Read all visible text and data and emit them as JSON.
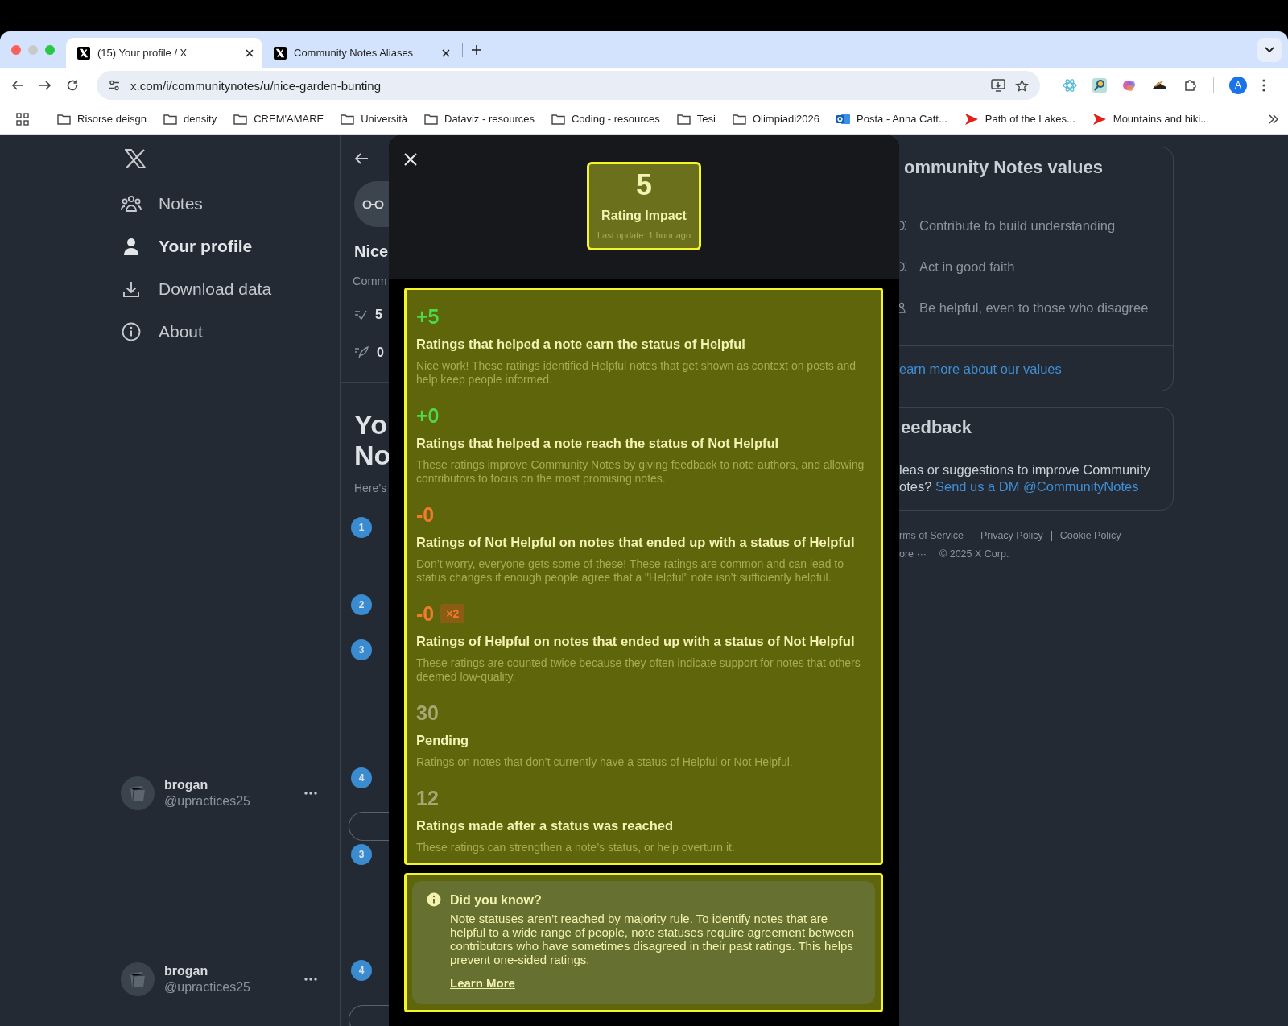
{
  "browser": {
    "tabs": [
      {
        "title": "(15) Your profile / X",
        "selected": true
      },
      {
        "title": "Community Notes Aliases",
        "selected": false
      }
    ],
    "address": "x.com/i/communitynotes/u/nice-garden-bunting",
    "profile_initial": "A",
    "bookmarks": [
      {
        "kind": "folder",
        "label": "Risorse deisgn"
      },
      {
        "kind": "folder",
        "label": "density"
      },
      {
        "kind": "folder",
        "label": "CREM'AMARE"
      },
      {
        "kind": "folder",
        "label": "Università"
      },
      {
        "kind": "folder",
        "label": "Dataviz - resources"
      },
      {
        "kind": "folder",
        "label": "Coding - resources"
      },
      {
        "kind": "folder",
        "label": "Tesi"
      },
      {
        "kind": "folder",
        "label": "Olimpiadi2026"
      },
      {
        "kind": "mail",
        "label": "Posta - Anna Catt..."
      },
      {
        "kind": "video",
        "label": "Path of the Lakes..."
      },
      {
        "kind": "video",
        "label": "Mountains and hiki..."
      }
    ]
  },
  "sidebar": {
    "nav": [
      {
        "kind": "people",
        "label": "Notes",
        "selected": false
      },
      {
        "kind": "person",
        "label": "Your profile",
        "selected": true
      },
      {
        "kind": "download",
        "label": "Download data",
        "selected": false
      },
      {
        "kind": "info",
        "label": "About",
        "selected": false
      }
    ],
    "accounts": [
      {
        "name": "brogan",
        "handle": "@upractices25"
      },
      {
        "name": "brogan",
        "handle": "@upractices25"
      }
    ]
  },
  "profile_peek": {
    "name": "Nice",
    "subtitle": "Comm",
    "stats": [
      {
        "kind": "rated",
        "value": "5"
      },
      {
        "kind": "written",
        "value": "0"
      }
    ],
    "heading_lines": [
      "Yo",
      "No"
    ],
    "intro": "Here’s",
    "steps": [
      "1",
      "2",
      "3",
      "4",
      "3",
      "4"
    ]
  },
  "modal": {
    "impact": {
      "value": "5",
      "label": "Rating Impact",
      "updated": "Last update: 1 hour ago"
    },
    "sections": [
      {
        "kind": "positive",
        "value": "+5",
        "title": "Ratings that helped a note earn the status of Helpful",
        "description": "Nice work! These ratings identified Helpful notes that get shown as context on posts and help keep people informed."
      },
      {
        "kind": "positive",
        "value": "+0",
        "title": "Ratings that helped a note reach the status of Not Helpful",
        "description": "These ratings improve Community Notes by giving feedback to note authors, and allowing contributors to focus on the most promising notes."
      },
      {
        "kind": "negative",
        "value": "-0",
        "title": "Ratings of Not Helpful on notes that ended up with a status of Helpful",
        "description": "Don’t worry, everyone gets some of these! These ratings are common and can lead to status changes if enough people agree that a \"Helpful\" note isn’t sufficiently helpful."
      },
      {
        "kind": "negative",
        "value": "-0",
        "multiplier": "×2",
        "title": "Ratings of Helpful on notes that ended up with a status of Not Helpful",
        "description": "These ratings are counted twice because they often indicate support for notes that others deemed low-quality."
      },
      {
        "kind": "neutral",
        "value": "30",
        "title": "Pending",
        "description": "Ratings on notes that don’t currently have a status of Helpful or Not Helpful."
      },
      {
        "kind": "neutral",
        "value": "12",
        "title": "Ratings made after a status was reached",
        "description": "These ratings can strengthen a note’s status, or help overturn it."
      }
    ],
    "info": {
      "title": "Did you know?",
      "text": "Note statuses aren’t reached by majority rule. To identify notes that are helpful to a wide range of people, note statuses require agreement between contributors who have sometimes disagreed in their past ratings. This helps prevent one-sided ratings.",
      "link": "Learn More"
    }
  },
  "right": {
    "values": {
      "title": "ommunity Notes values",
      "items": [
        {
          "kind": "bulb",
          "label": "Contribute to build understanding"
        },
        {
          "kind": "bulb",
          "label": "Act in good faith"
        },
        {
          "kind": "person",
          "label": "Be helpful, even to those who disagree"
        }
      ],
      "link": "earn more about our values"
    },
    "feedback": {
      "title": "eedback",
      "lines": [
        "leas or suggestions to improve Community",
        "otes?"
      ],
      "link": "Send us a DM @CommunityNotes"
    },
    "footer_links": [
      "rms of Service",
      "Privacy Policy",
      "Cookie Policy"
    ],
    "more": "ore ···",
    "copyright": "© 2025 X Corp."
  }
}
